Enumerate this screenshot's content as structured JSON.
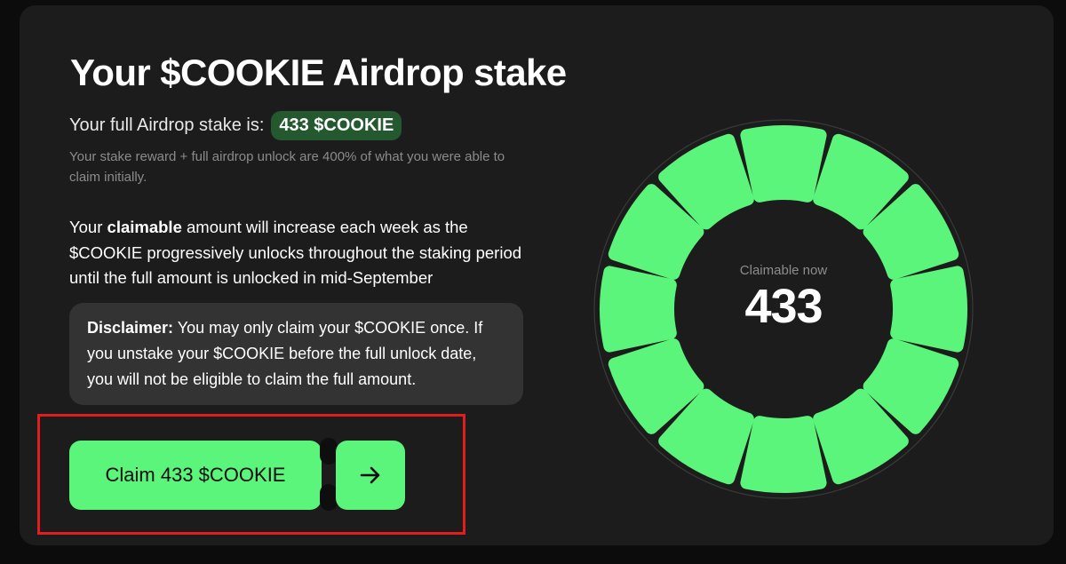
{
  "header": {
    "title": "Your $COOKIE Airdrop stake"
  },
  "stake": {
    "label": "Your full Airdrop stake is:",
    "amount_badge": "433 $COOKIE",
    "note": "Your stake reward + full airdrop unlock are 400% of what you were able to claim initially."
  },
  "description": {
    "pre": "Your ",
    "emphasis": "claimable",
    "post": " amount will increase each week as the $COOKIE progressively unlocks throughout the staking period until the full amount is unlocked in mid-September"
  },
  "disclaimer": {
    "label": "Disclaimer:",
    "text": " You may only claim your $COOKIE once. If you unstake your $COOKIE before the full unlock date, you will not be eligible to claim the full amount."
  },
  "actions": {
    "claim_label": "Claim 433 $COOKIE",
    "arrow_icon": "arrow-right-icon"
  },
  "progress": {
    "label": "Claimable now",
    "value": "433",
    "segments_total": 12,
    "segments_filled": 12,
    "fill_color": "#5af57a",
    "track_color": "#3a3a3a"
  },
  "colors": {
    "accent": "#5af57a",
    "badge_bg": "#24582e",
    "highlight_border": "#e11d1d"
  }
}
